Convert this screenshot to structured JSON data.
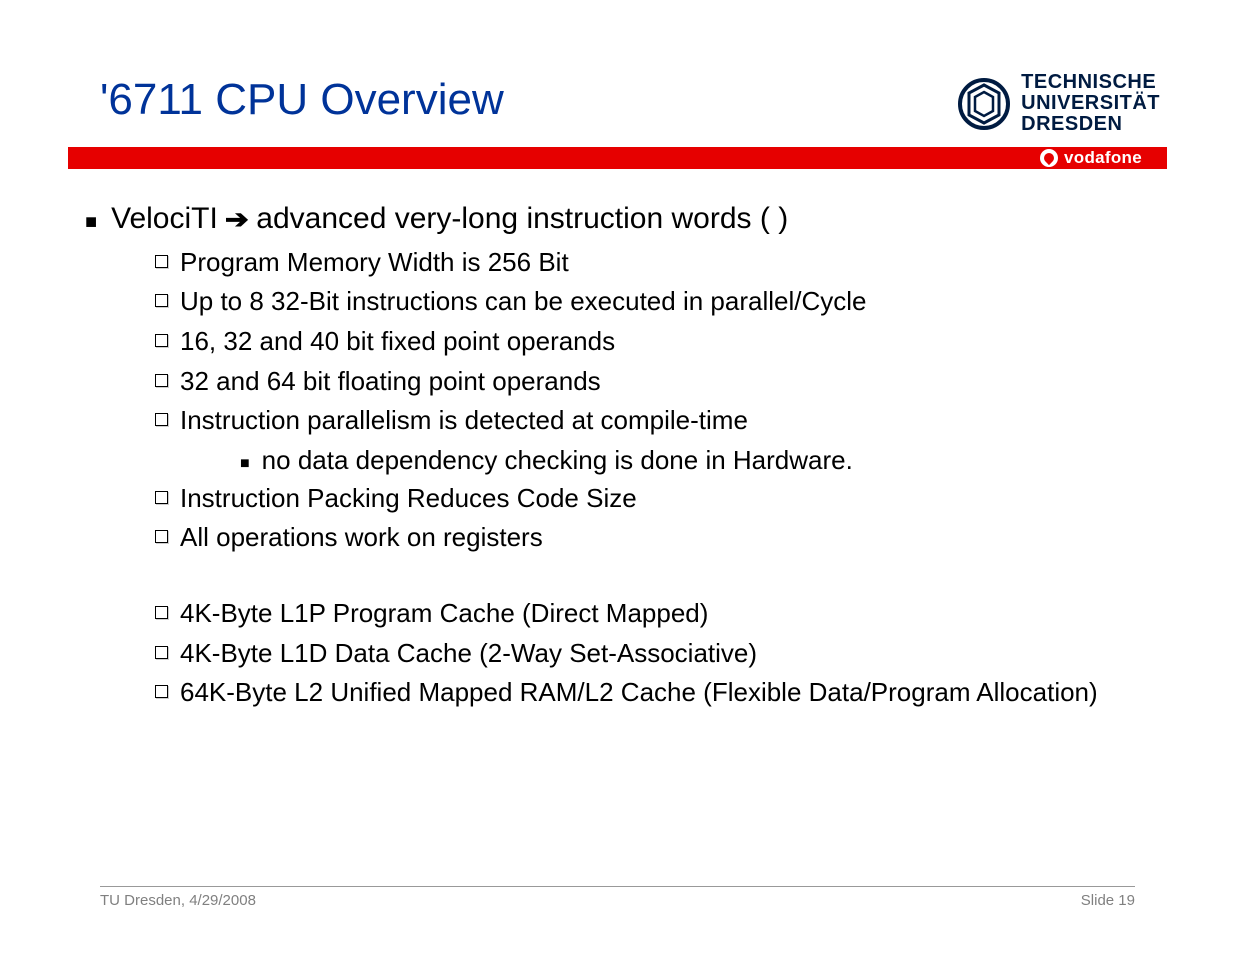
{
  "title": "'6711 CPU Overview",
  "logo": {
    "tud_line1": "TECHNISCHE",
    "tud_line2": "UNIVERSITÄT",
    "tud_line3": "DRESDEN",
    "vodafone": "vodafone"
  },
  "main": {
    "line_pre": "VelociTI ",
    "line_post": " advanced very-long instruction words (          )"
  },
  "bullets_a": [
    "Program Memory Width is 256 Bit",
    "Up to 8 32-Bit instructions can be executed in parallel/Cycle",
    "16, 32 and 40 bit fixed point operands",
    "32 and 64 bit floating point operands",
    "Instruction parallelism is detected at compile-time"
  ],
  "sub_a": "no data dependency checking is done in Hardware.",
  "bullets_b": [
    "Instruction Packing Reduces Code Size",
    "All operations work on registers"
  ],
  "bullets_c": [
    "4K-Byte L1P Program Cache (Direct Mapped)",
    "4K-Byte L1D Data Cache (2-Way Set-Associative)",
    "64K-Byte L2 Unified Mapped RAM/L2 Cache (Flexible Data/Program Allocation)"
  ],
  "footer": {
    "left": "TU Dresden, 4/29/2008",
    "right": "Slide 19"
  }
}
